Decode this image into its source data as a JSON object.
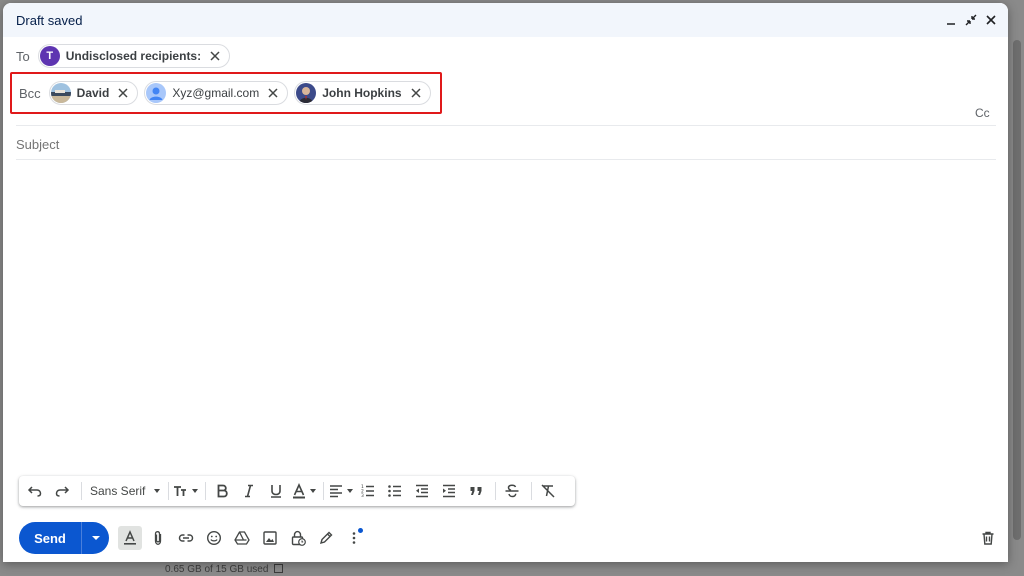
{
  "header": {
    "title": "Draft saved"
  },
  "to": {
    "label": "To",
    "chips": [
      {
        "initial": "T",
        "name": "Undisclosed recipients:",
        "avatar_color": "#5e35b1"
      }
    ]
  },
  "bcc": {
    "label": "Bcc",
    "chips": [
      {
        "name": "David",
        "avatar": "landscape-photo"
      },
      {
        "name": "Xyz@gmail.com",
        "avatar": "default-person"
      },
      {
        "name": "John Hopkins",
        "avatar": "person-photo"
      }
    ]
  },
  "cc_label": "Cc",
  "subject": {
    "placeholder": "Subject",
    "value": ""
  },
  "toolbar": {
    "font": "Sans Serif"
  },
  "send": {
    "label": "Send"
  },
  "backdrop": {
    "footer": "0.65 GB of 15 GB used"
  },
  "colors": {
    "accent": "#0b57d0",
    "highlight": "#e0191a"
  }
}
